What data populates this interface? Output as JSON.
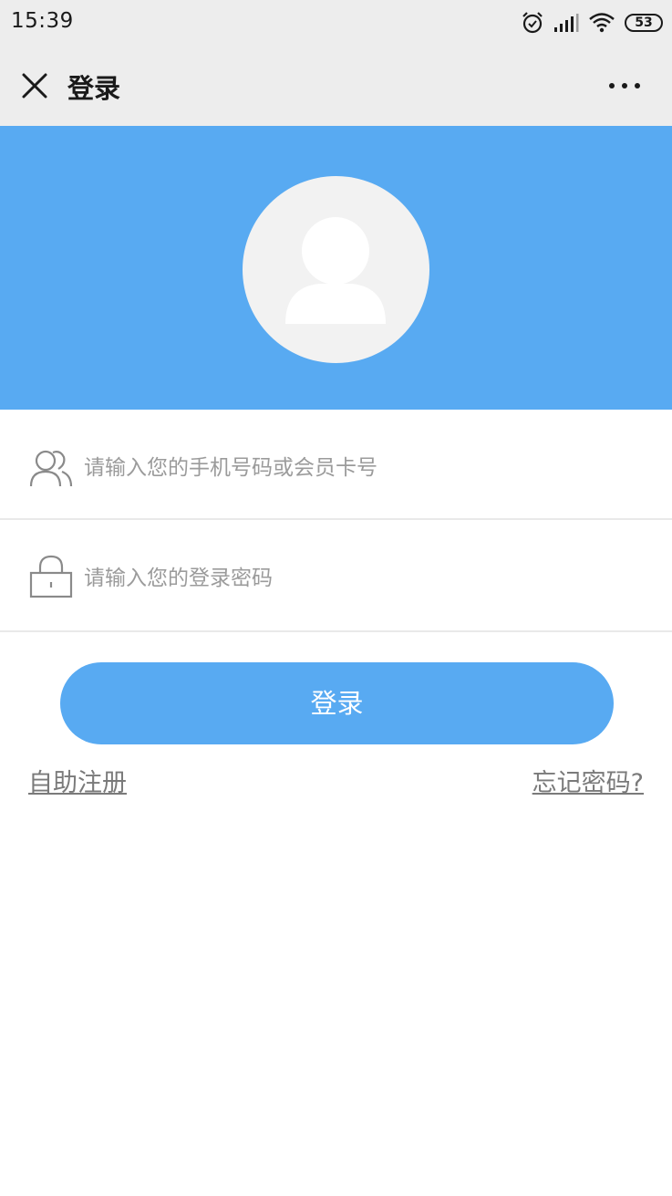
{
  "status_bar": {
    "time": "15:39",
    "battery": "53",
    "icons": [
      "alarm-icon",
      "signal-icon",
      "wifi-icon",
      "battery-icon"
    ]
  },
  "nav": {
    "title": "登录",
    "close_icon": "close-icon",
    "more_icon": "more-icon"
  },
  "header": {
    "background_color": "#58aaf2",
    "avatar_icon": "user-avatar-icon"
  },
  "form": {
    "username_placeholder": "请输入您的手机号码或会员卡号",
    "password_placeholder": "请输入您的登录密码",
    "username_value": "",
    "password_value": ""
  },
  "actions": {
    "login_label": "登录",
    "register_label": "自助注册",
    "forgot_label": "忘记密码?"
  },
  "colors": {
    "accent": "#58aaf2",
    "nav_bg": "#ededed",
    "placeholder": "#9b9b9b",
    "link": "#7a7a7a"
  }
}
